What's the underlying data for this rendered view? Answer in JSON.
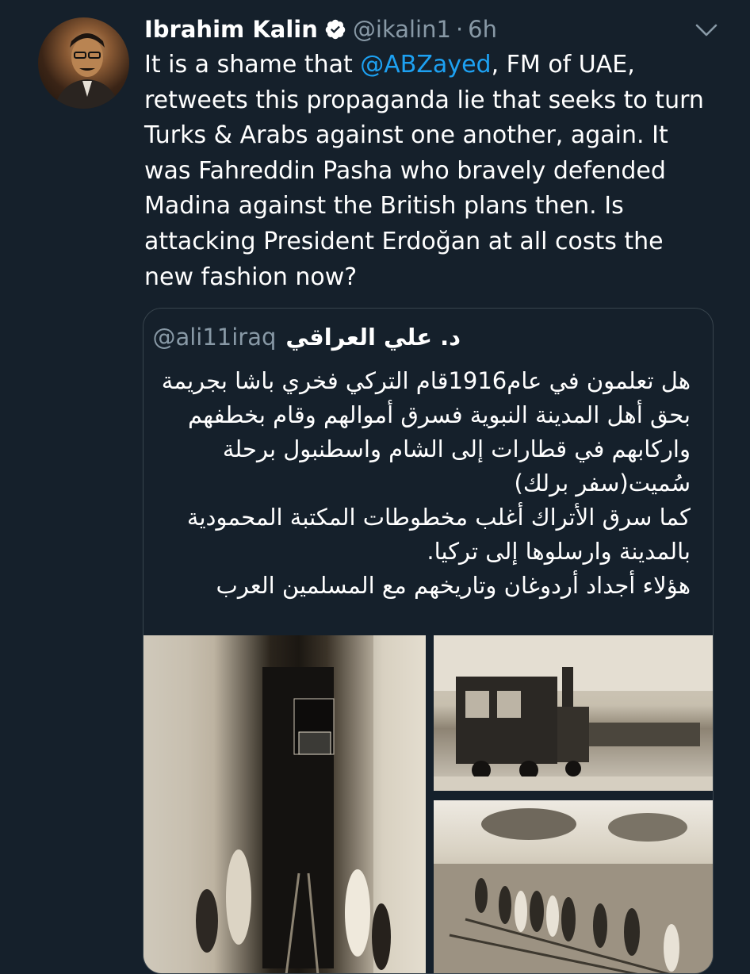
{
  "tweet": {
    "author_name": "Ibrahim Kalin",
    "handle": "@ikalin1",
    "separator": "·",
    "time": "6h",
    "text_before_mention": "It is a shame that ",
    "mention": "@ABZayed",
    "text_after_mention": ", FM of UAE, retweets this propaganda lie that seeks to turn Turks & Arabs against one another, again. It was Fahreddin Pasha who bravely defended Madina against the British plans then. Is attacking President Erdoğan at all costs the new fashion now?"
  },
  "quoted_tweet": {
    "author_name": "د. علي العراقي",
    "handle": "@ali11iraq",
    "lines": [
      "هل تعلمون في عام1916قام التركي فخري باشا بجريمة",
      "بحق أهل المدينة النبوية فسرق أموالهم وقام بخطفهم",
      "واركابهم في قطارات إلى الشام واسطنبول برحلة",
      "سُميت(سفر برلك)",
      "كما سرق الأتراك أغلب مخطوطات المكتبة المحمودية",
      "بالمدينة وارسلوها إلى تركيا.",
      "هؤلاء أجداد أردوغان وتاريخهم مع المسلمين العرب"
    ]
  },
  "icons": {
    "verified": "verified-badge-icon",
    "caret": "chevron-down-icon"
  },
  "colors": {
    "background": "#15202b",
    "accent": "#1da1f2",
    "secondary_text": "#8899a6",
    "border": "#38444d"
  }
}
